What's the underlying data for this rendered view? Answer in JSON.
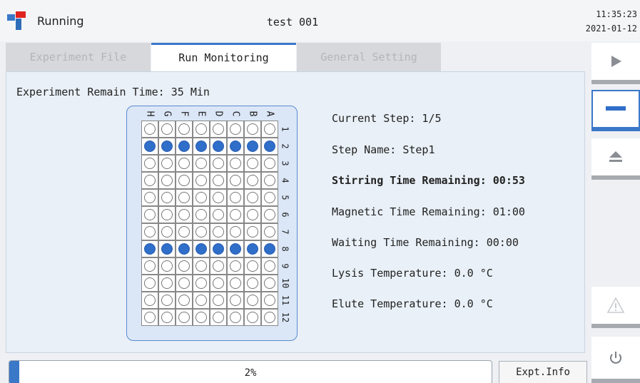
{
  "header": {
    "status": "Running",
    "experiment_name": "test 001",
    "time": "11:35:23",
    "date": "2021-01-12"
  },
  "tabs": [
    {
      "label": "Experiment File",
      "active": false
    },
    {
      "label": "Run Monitoring",
      "active": true
    },
    {
      "label": "General Setting",
      "active": false
    }
  ],
  "main": {
    "remain_time": "Experiment Remain Time: 35 Min",
    "plate": {
      "columns": [
        "H",
        "G",
        "F",
        "E",
        "D",
        "C",
        "B",
        "A"
      ],
      "rows": [
        "1",
        "2",
        "3",
        "4",
        "5",
        "6",
        "7",
        "8",
        "9",
        "10",
        "11",
        "12"
      ],
      "filled_rows": [
        "2",
        "8"
      ]
    },
    "info": {
      "current_step": "Current Step: 1/5",
      "step_name": "Step Name: Step1",
      "stirring": "Stirring Time Remaining: 00:53",
      "magnetic": "Magnetic Time Remaining: 01:00",
      "waiting": "Waiting Time Remaining: 00:00",
      "lysis": "Lysis Temperature: 0.0 °C",
      "elute": "Elute Temperature: 0.0 °C"
    }
  },
  "progress": {
    "value_percent": 2,
    "label": "2%"
  },
  "expt_info_label": "Expt.Info",
  "sidebar": {
    "buttons": [
      {
        "name": "play",
        "icon": "play-icon",
        "active": false
      },
      {
        "name": "stop",
        "icon": "minus-icon",
        "active": true
      },
      {
        "name": "eject",
        "icon": "eject-icon",
        "active": false
      },
      {
        "name": "warning",
        "icon": "warning-icon",
        "active": false
      },
      {
        "name": "power",
        "icon": "power-icon",
        "active": false
      }
    ]
  },
  "colors": {
    "accent": "#3a78c8",
    "logo_red": "#e0231f",
    "well_filled": "#2f6ec9"
  }
}
